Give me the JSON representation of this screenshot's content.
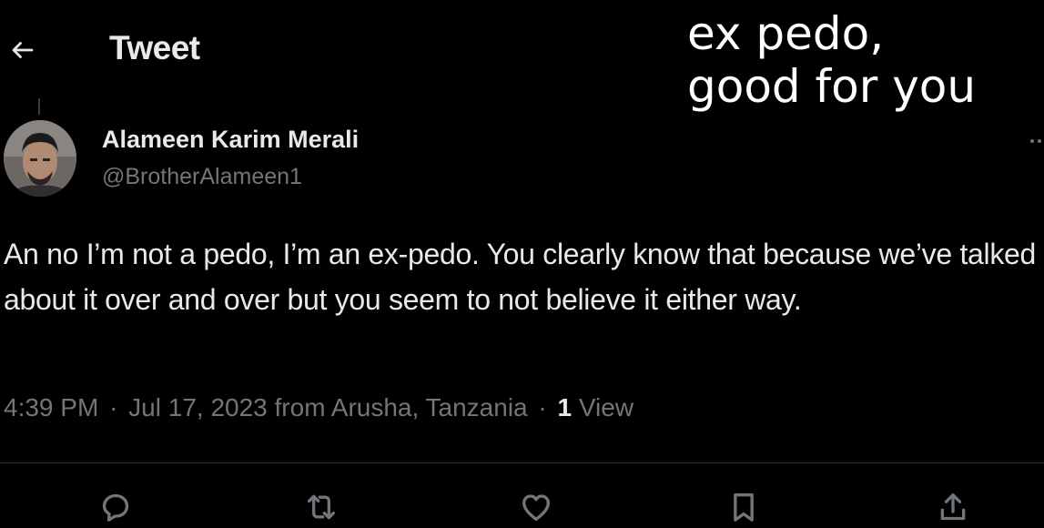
{
  "overlay": {
    "caption": "ex pedo,\ngood for you"
  },
  "header": {
    "back_icon": "arrow-left-icon",
    "title": "Tweet"
  },
  "tweet": {
    "author": {
      "name": "Alameen Karim Merali",
      "handle": "@BrotherAlameen1",
      "avatar_icon": "avatar"
    },
    "text": "An no I’m not a pedo, I’m an ex-pedo. You clearly know that because we’ve talked about it over and over but you seem to not believe it either way.",
    "time": "4:39 PM",
    "separator": "·",
    "date": "Jul 17, 2023",
    "location": "from Arusha, Tanzania",
    "view_count": "1",
    "views_label": "View"
  },
  "actions": [
    {
      "name": "reply",
      "icon": "reply-icon"
    },
    {
      "name": "retweet",
      "icon": "retweet-icon"
    },
    {
      "name": "like",
      "icon": "heart-icon"
    },
    {
      "name": "bookmark",
      "icon": "bookmark-icon"
    },
    {
      "name": "share",
      "icon": "share-icon"
    }
  ],
  "colors": {
    "background": "#000000",
    "primary_text": "#e7e9ea",
    "secondary_text": "#71767b",
    "divider": "#2f3336"
  }
}
